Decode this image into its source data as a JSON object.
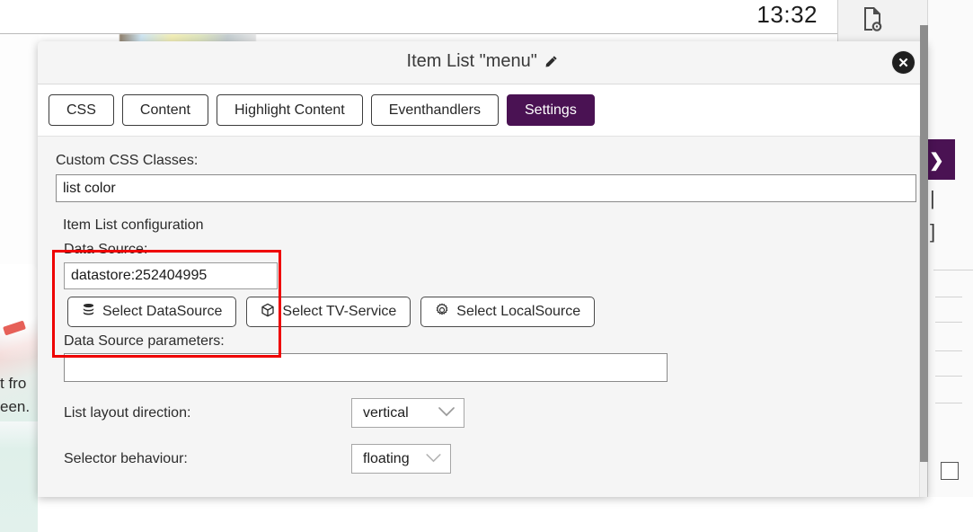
{
  "background": {
    "clock": "13:32",
    "left_text_line1": "t fro",
    "left_text_line2": "een.",
    "toolbar_icons": [
      {
        "name": "document-settings-icon",
        "glyph": "⚙"
      },
      {
        "name": "document-code-icon",
        "glyph": "<>"
      }
    ],
    "rail": {
      "collapse_chevron": "❯",
      "glyph_bar": "|",
      "glyph_bracket": "]"
    }
  },
  "modal": {
    "title": "Item List \"menu\"",
    "edit_icon": "pencil-icon",
    "close_label": "✕",
    "tabs": [
      {
        "label": "CSS",
        "active": false
      },
      {
        "label": "Content",
        "active": false
      },
      {
        "label": "Highlight Content",
        "active": false
      },
      {
        "label": "Eventhandlers",
        "active": false
      },
      {
        "label": "Settings",
        "active": true
      }
    ],
    "active_tab_color": "#4a1253",
    "form": {
      "custom_css_label": "Custom CSS Classes:",
      "custom_css_value": "list color",
      "custom_css_placeholder": "",
      "section_title": "Item List configuration",
      "data_source_label": "Data Source:",
      "data_source_value": "datastore:252404995",
      "data_source_placeholder": "",
      "source_buttons": [
        {
          "icon": "database-icon",
          "label": "Select DataSource"
        },
        {
          "icon": "cube-icon",
          "label": "Select TV-Service"
        },
        {
          "icon": "gear-icon",
          "label": "Select LocalSource"
        }
      ],
      "params_label": "Data Source parameters:",
      "params_value": "",
      "params_placeholder": "",
      "layout_direction_label": "List layout direction:",
      "layout_direction_value": "vertical",
      "selector_behaviour_label": "Selector behaviour:",
      "selector_behaviour_value": "floating"
    }
  },
  "annotation": {
    "color": "#ee0000",
    "target": "data-source-group"
  }
}
